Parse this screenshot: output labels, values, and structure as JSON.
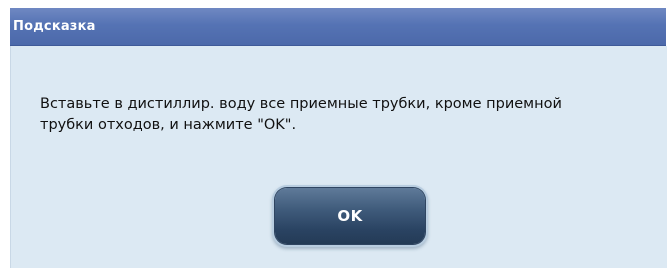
{
  "dialog": {
    "title": "Подсказка",
    "message": "Вставьте в дистиллир. воду все приемные трубки, кроме приемной\nтрубки отходов, и нажмите \"OK\".",
    "ok_label": "OK"
  },
  "colors": {
    "titlebar": "#5573b4",
    "body_background": "#dce9f3",
    "button": "#2a4362"
  }
}
